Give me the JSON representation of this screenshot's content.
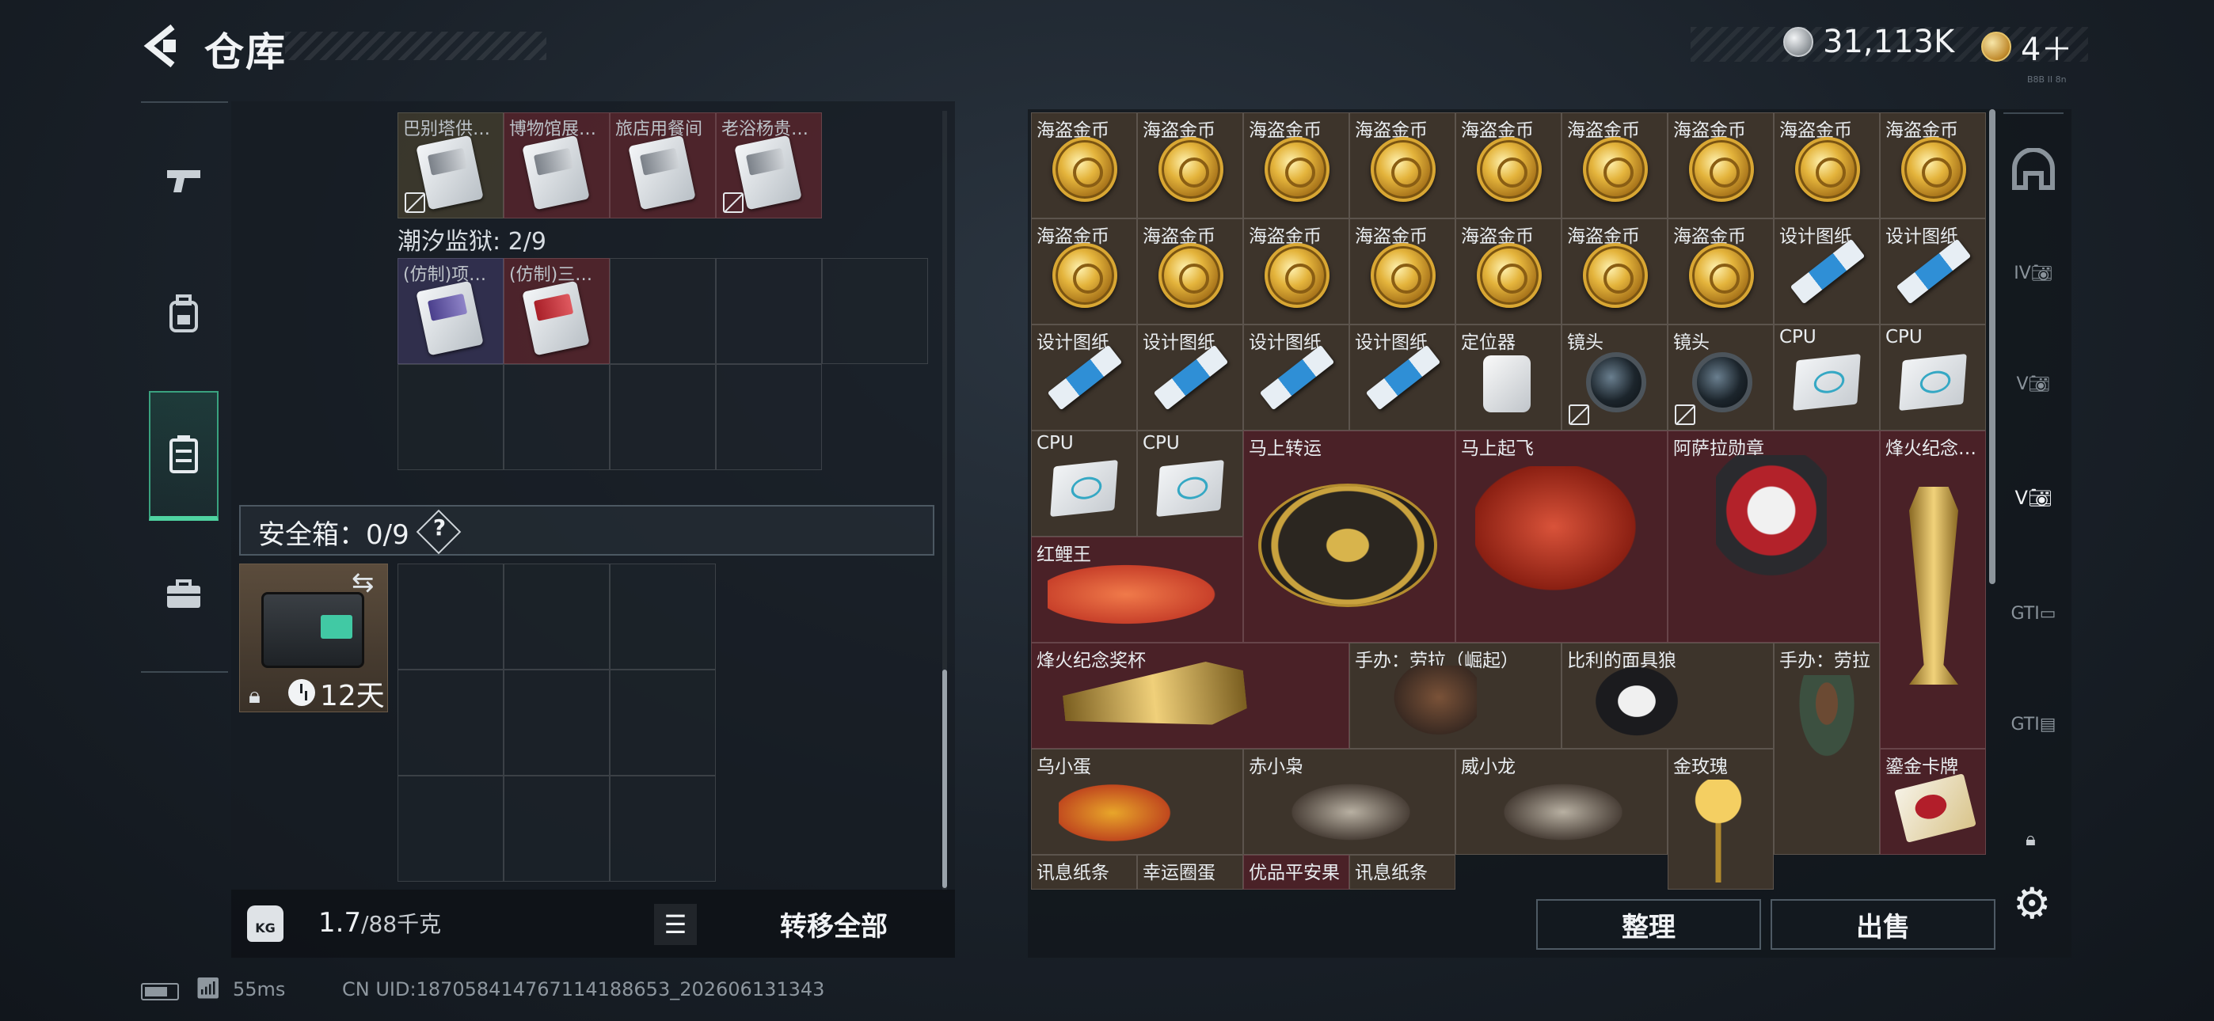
{
  "header": {
    "title": "仓库",
    "silver_amount": "31,113K",
    "gold_amount": "4＋",
    "tiny_label": "B8B II 8n"
  },
  "left_rail": [
    "pistol-icon",
    "backpack-icon",
    "chest-rig-icon",
    "briefcase-icon"
  ],
  "top_items": [
    {
      "label": "巴别塔供…",
      "bg": "olive",
      "nolock": true
    },
    {
      "label": "博物馆展…",
      "bg": "red",
      "nolock": false
    },
    {
      "label": "旅店用餐间",
      "bg": "red",
      "nolock": false
    },
    {
      "label": "老浴杨贵…",
      "bg": "red",
      "nolock": true
    }
  ],
  "prison": {
    "label": "潮汐监狱: 2/9",
    "items": [
      {
        "label": "(仿制)项…",
        "bg": "purple",
        "art": "purple"
      },
      {
        "label": "(仿制)三…",
        "bg": "red",
        "art": "red"
      }
    ]
  },
  "safe_box": {
    "label": "安全箱：0/9",
    "help": "?",
    "days": "12天"
  },
  "weight": {
    "icon_text": "KG",
    "current": "1.7",
    "max": "/88千克"
  },
  "buttons": {
    "transfer_all": "转移全部",
    "organize": "整理",
    "sell": "出售"
  },
  "right_items": {
    "coin": "海盗金币",
    "blueprint": "设计图纸",
    "locator": "定位器",
    "lens": "镜头",
    "cpu": "CPU",
    "wheel": "马上转运",
    "horse": "马上起飞",
    "medal": "阿萨拉勋章",
    "trophy": "烽火纪念…",
    "fish": "红鲤王",
    "trophy2": "烽火纪念奖杯",
    "figure1": "手办：劳拉（崛起）",
    "mask": "比利的面具狼",
    "figure2": "手办：劳拉",
    "egg": "乌小蛋",
    "robot1": "赤小枭",
    "robot2": "威小龙",
    "rose": "金玫瑰",
    "goldcard": "鎏金卡牌",
    "bottom_row": [
      "讯息纸条",
      "幸运圈蛋",
      "优品平安果",
      "讯息纸条"
    ]
  },
  "right_rail": [
    "helmet-icon",
    "iv-camera-icon",
    "v-camera-icon",
    "v-camera-active-icon",
    "gti-icon",
    "gti-card-icon"
  ],
  "status": {
    "ping": "55ms",
    "uid": "CN UID:187058414767114188653_202606131343"
  }
}
